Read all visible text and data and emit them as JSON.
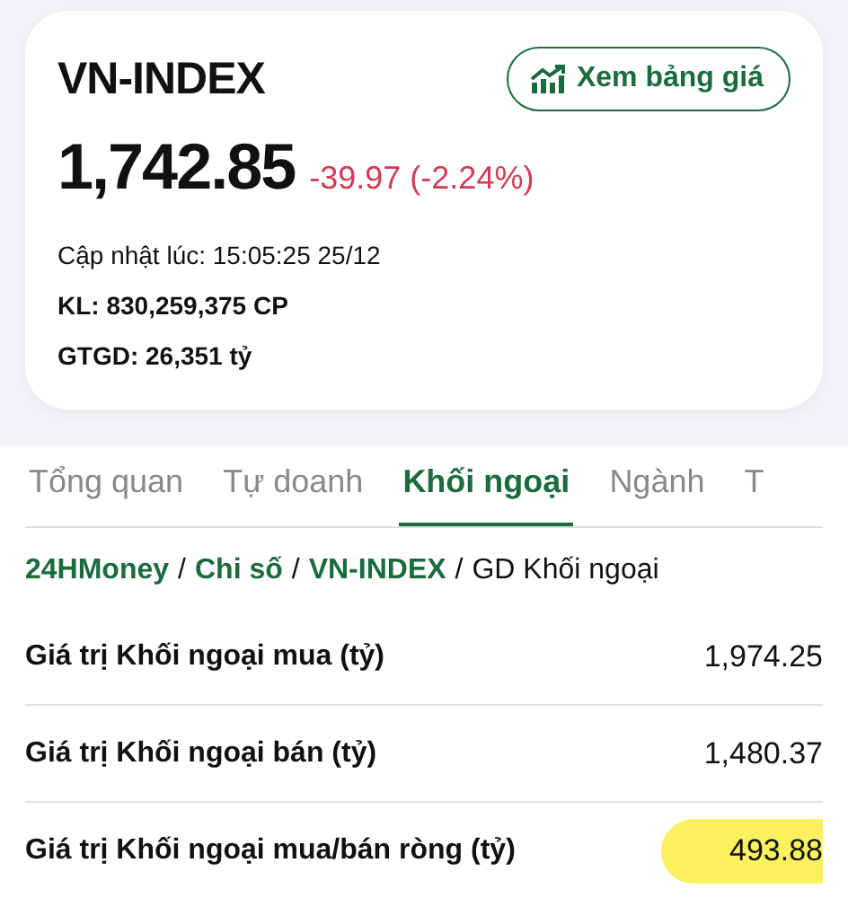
{
  "index_card": {
    "symbol": "VN-INDEX",
    "button": "Xem bảng giá",
    "price": "1,742.85",
    "change": "-39.97 (-2.24%)",
    "negative": true,
    "updated": "Cập nhật lúc: 15:05:25 25/12",
    "volume": "KL: 830,259,375 CP",
    "value": "GTGD: 26,351 tỷ"
  },
  "tabs": [
    {
      "label": "Tổng quan",
      "selected": false
    },
    {
      "label": "Tự doanh",
      "selected": false
    },
    {
      "label": "Khối ngoại",
      "selected": true
    },
    {
      "label": "Ngành",
      "selected": false
    },
    {
      "label": "T",
      "selected": false
    }
  ],
  "breadcrumb": [
    {
      "label": "24HMoney",
      "link": true
    },
    {
      "separator": "/",
      "label": "Chi số",
      "link": true
    },
    {
      "separator": "/",
      "label": "VN-INDEX",
      "link": true
    },
    {
      "separator": "/",
      "label": "GD Khối ngoại",
      "link": false
    }
  ],
  "rows": [
    {
      "label": "Giá trị Khối ngoại mua (tỷ)",
      "value": "1,974.25",
      "highlighted": false
    },
    {
      "label": "Giá trị Khối ngoại bán (tỷ)",
      "value": "1,480.37",
      "highlighted": false
    },
    {
      "label": "Giá trị Khối ngoại mua/bán ròng (tỷ)",
      "value": "493.88",
      "highlighted": true
    }
  ]
}
